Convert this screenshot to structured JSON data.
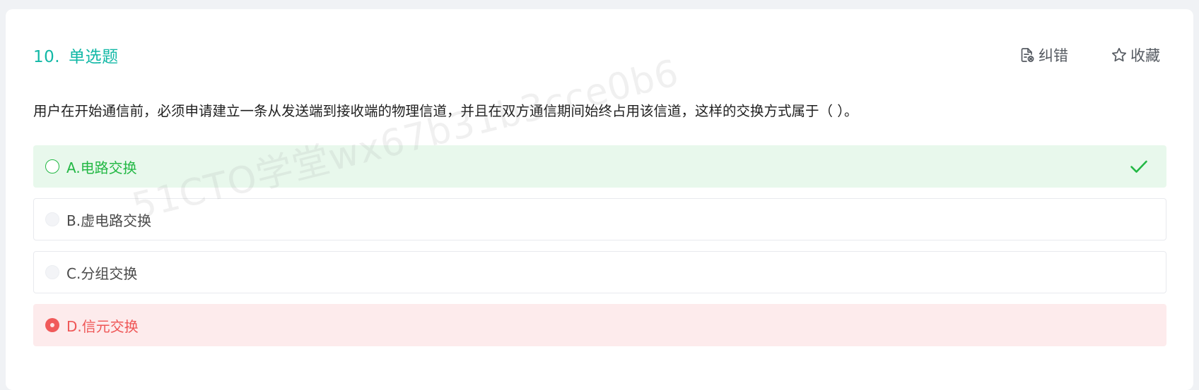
{
  "question": {
    "number": "10.",
    "type": "单选题",
    "stem": "用户在开始通信前，必须申请建立一条从发送端到接收端的物理信道，并且在双方通信期间始终占用该信道，这样的交换方式属于（ ）。"
  },
  "actions": {
    "report_label": "纠错",
    "report_icon": "report-error-icon",
    "favorite_label": "收藏",
    "favorite_icon": "star-outline-icon"
  },
  "options": [
    {
      "label": "A.电路交换",
      "state": "correct"
    },
    {
      "label": "B.虚电路交换",
      "state": "none"
    },
    {
      "label": "C.分组交换",
      "state": "none"
    },
    {
      "label": "D.信元交换",
      "state": "selected-wrong"
    }
  ],
  "watermark": "51CTO学堂wx67b31b3cce0b6",
  "colors": {
    "accent_teal": "#12b8a6",
    "correct_green": "#23b845",
    "correct_bg": "#e8f8ec",
    "wrong_red": "#ef5656",
    "wrong_bg": "#fdebec",
    "page_bg": "#f0f2f5"
  }
}
